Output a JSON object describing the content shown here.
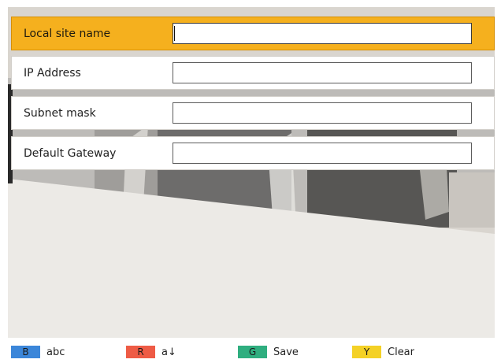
{
  "form": {
    "rows": [
      {
        "label": "Local site name",
        "value": "",
        "selected": true
      },
      {
        "label": "IP Address",
        "value": "",
        "selected": false
      },
      {
        "label": "Subnet mask",
        "value": "",
        "selected": false
      },
      {
        "label": "Default Gateway",
        "value": "",
        "selected": false
      }
    ]
  },
  "footer": {
    "keys": [
      {
        "badge": "B",
        "label": "abc",
        "color": "#3b86d9"
      },
      {
        "badge": "R",
        "label": "a↓",
        "color": "#ee5b45"
      },
      {
        "badge": "G",
        "label": "Save",
        "color": "#2fae7f"
      },
      {
        "badge": "Y",
        "label": "Clear",
        "color": "#f4d126"
      }
    ]
  },
  "colors": {
    "selected_row": "#f5b01e",
    "screen_background": "#d7d3cd"
  }
}
